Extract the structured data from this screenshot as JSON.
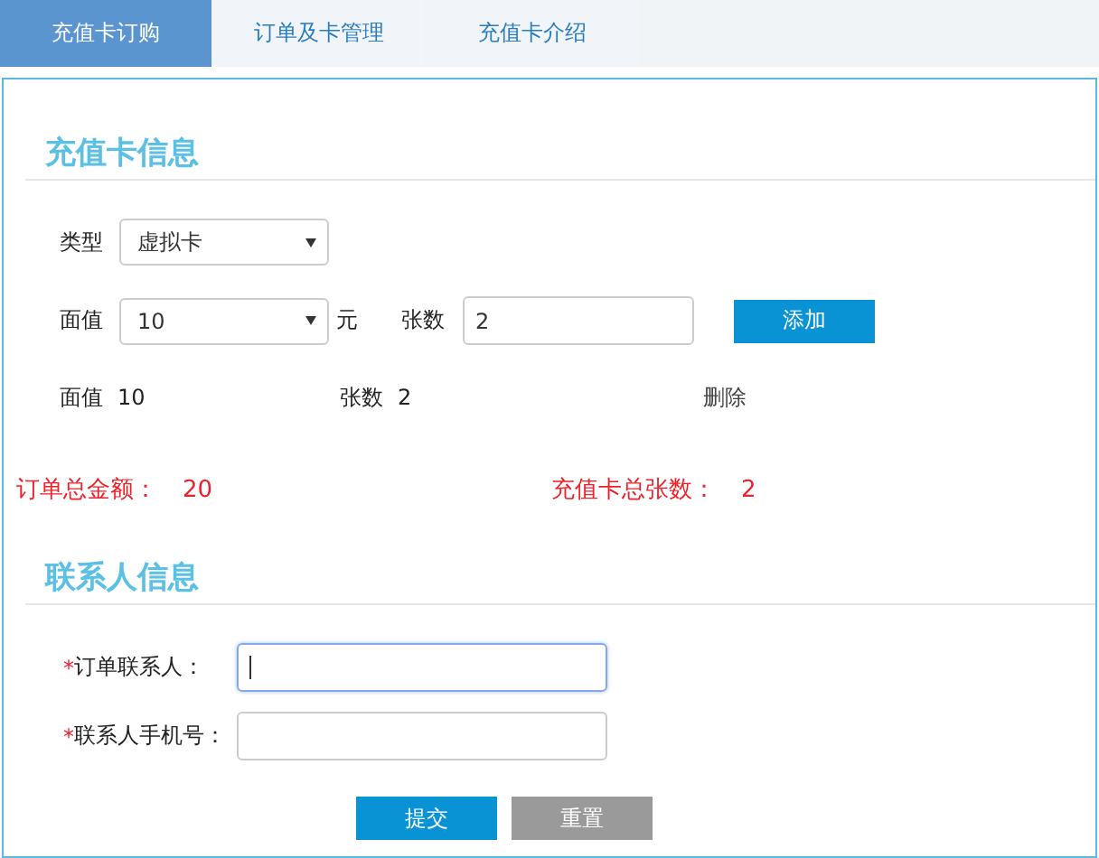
{
  "tabs": [
    {
      "label": "充值卡订购",
      "selected": true
    },
    {
      "label": "订单及卡管理",
      "selected": false
    },
    {
      "label": "充值卡介绍",
      "selected": false
    }
  ],
  "card_section": {
    "title": "充值卡信息",
    "type": {
      "label": "类型",
      "value": "虚拟卡"
    },
    "face_value": {
      "label": "面值",
      "value": "10",
      "unit": "元"
    },
    "count": {
      "label": "张数",
      "value": "2"
    },
    "add_button": "添加",
    "items": [
      {
        "face_label": "面值",
        "face_value": "10",
        "count_label": "张数",
        "count_value": "2",
        "delete": "删除"
      }
    ],
    "totals": [
      {
        "label": "订单总金额：",
        "value": "20"
      },
      {
        "label": "充值卡总张数：",
        "value": "2"
      }
    ]
  },
  "contact_section": {
    "title": "联系人信息",
    "fields": [
      {
        "required_mark": "*",
        "label": "订单联系人：",
        "focused": true
      },
      {
        "required_mark": "*",
        "label": "联系人手机号：",
        "focused": false
      }
    ]
  },
  "buttons": [
    {
      "label": "提交",
      "kind": "primary"
    },
    {
      "label": "重置",
      "kind": "secondary"
    }
  ]
}
